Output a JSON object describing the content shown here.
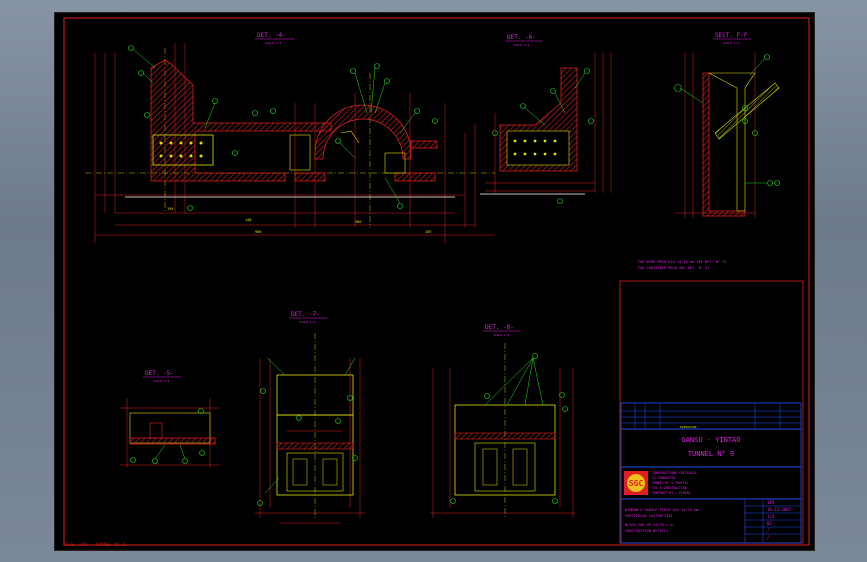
{
  "drawing": {
    "details": {
      "det4": {
        "title": "DET. -4-",
        "scale": "SCALE 1:5"
      },
      "det6": {
        "title": "DET. -6-",
        "scale": "SCALE 1:5"
      },
      "secf": {
        "title": "SECT. F-F",
        "scale": "SCALE 1:5"
      },
      "det5": {
        "title": "DET. -5-",
        "scale": "SCALE 1:5"
      },
      "det7": {
        "title": "DET. -7-",
        "scale": "SCALE 1:5"
      },
      "det8": {
        "title": "DET. -8-",
        "scale": "SCALE 1:5"
      }
    },
    "dimensions": {
      "d1": "195",
      "d2": "140",
      "d3": "900",
      "d4": "580",
      "d5": "165"
    },
    "notes": {
      "n1": "FOR WIRE MESH DIA 14-15 mm SEE DET. N° 51",
      "n2": "FOR CONTAINER MESH SEE DET. N° 51"
    }
  },
  "title_block": {
    "header": "ELEVATION",
    "project": "GANSU - YINTAO",
    "tunnel": "TUNNEL N° 9",
    "company": {
      "logo": "SGC",
      "lines": [
        "CONSTRUCTIONS SPECIALES",
        "IL CONSORZIO",
        "TUNNEL N° 9 TRAFFIC",
        "TEL & CONSTRUCTION",
        "CONTRACT 01 — YINTAO"
      ]
    },
    "description": [
      "WINDOW & SADDLE FIELD DIA 14-15 mm",
      "PARTICULAR COSTRUTTIVI",
      "BLOCK CAR OF 14/75 c.m.",
      "CONSTRUCTION DETAILS"
    ],
    "fields": {
      "sheet_no": "185",
      "date": "10-12-2007",
      "scale": "1:5",
      "rev": "02",
      "drawn": "/",
      "checked": "/"
    }
  },
  "footer_label": "FILE: CAD - TUNNEL NO.9"
}
